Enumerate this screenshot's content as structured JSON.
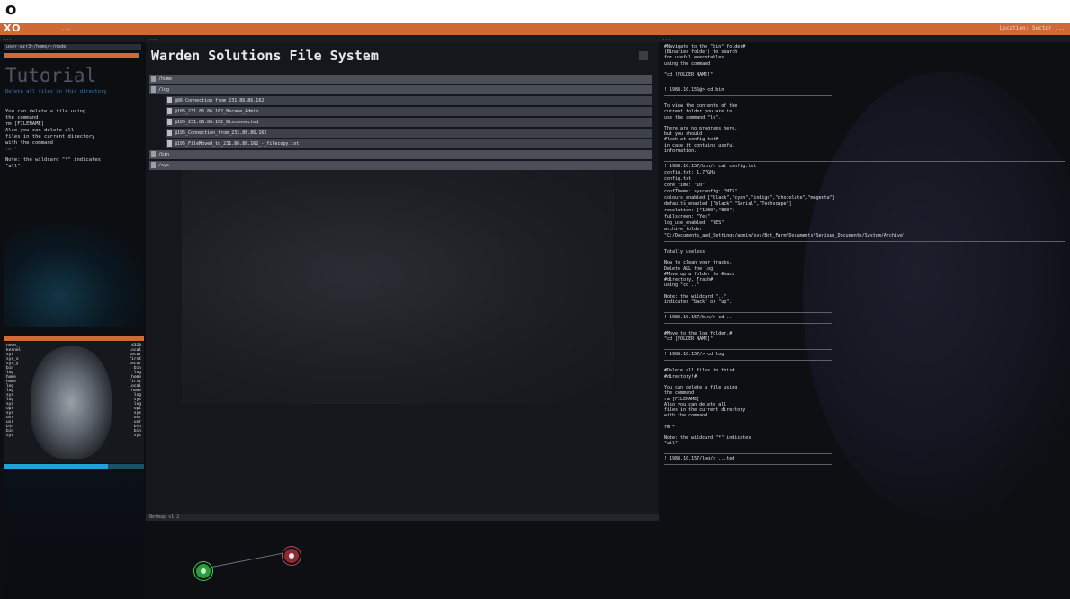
{
  "outer": {
    "mark": "o"
  },
  "topbar": {
    "logo": "XO",
    "small": "...",
    "right": "Location: Sector  ..."
  },
  "left": {
    "panel_title": "...",
    "path": "user-ezr3~/home/~/node",
    "tutorial_title": "Tutorial",
    "subtitle": "Delete all files in this directory",
    "body": "You can delete a file using\nthe command\nrm [FILENAME]\nAlso you can delete all\nfiles in the current directory\nwith the command",
    "tag": "rm *",
    "note": "Note: the wildcard \"*\" indicates\n\"all\".",
    "ram_col1": "node_\nkernel\nsys\nsys_x\nsys_y\nbin\nlog\nhome\nhome\nlog\nlog\nsys\nlog\nsys\nopt\nsys\nusr\nusr\nbin\nbin\nsys",
    "ram_col2": "4320\nlocal\nsecur\nfirst\nsecur\nbin\nlog\nhome\nfirst\nlocal\nhome\nlog\nsys\nlog\nopt\nsys\nusr\nusr\nbin\nbin\nsys"
  },
  "mid": {
    "panel_title": "...",
    "title": "Warden Solutions File System",
    "tree": [
      {
        "label": "/home",
        "type": "folder"
      },
      {
        "label": "/log",
        "type": "folder"
      },
      {
        "label": "@86_Connection_from_231.86.86.162",
        "type": "file"
      },
      {
        "label": "@105_231.86.86.162_Became_Admin",
        "type": "file"
      },
      {
        "label": "@105_231.86.86.162_Disconnected",
        "type": "file"
      },
      {
        "label": "@195_Connection_from_231.86.86.162",
        "type": "file"
      },
      {
        "label": "@195_FileMoved_to_231.86.86.162_-_filecopy.txt",
        "type": "file"
      },
      {
        "label": "/bin",
        "type": "folder"
      },
      {
        "label": "/sys",
        "type": "folder"
      }
    ],
    "display_title": "Netmap v1.2"
  },
  "right": {
    "panel_title": "...",
    "lines": [
      "#Navigate to the \"bin\" folder#\n(Binaries folder) to search\nfor useful executables\nusing the command\n\n\"cd [FOLDER NAME]\"",
      "! 1988.10.155@> cd bin",
      "To view the contents of the\ncurrent folder you are in\nuse the command \"ls\".\n\nThere are no programs here,\nbut you should\n#look at config.txt#\nin case it contains useful\ninformation.",
      "! 1988.10.157/bin/> cat config.txt\nconfig.txt: 1.77GHz\nconfig.txt\ncore_time: \"10\"\nconfTheme: sysconfig: \"HTS\"\ncolours_enabled [\"black\",\"cyan\",\"indigo\",\"chocolate\",\"magenta\"]\ndefaults_enabled [\"black\",\"Serial\",\"Techscape\"]\nresolution: [\"1280\",\"800\"]\nfullscreen: \"Yes\"\nlog_use_enabled: \"YES\"\narchive_folder\n\"C:/Documents_and_Settings/admin/sys/Bot_Farm/Documents/Serious_Documents/System/Archive\"",
      "Totally useless!\n\nNow to clean your tracks.\nDelete ALL the log\n#Move up a folder to #back\n#directory, Trash#\nusing \"cd ..\"\n\nNote: the wildcard \"..\"\nindicates \"back\" or \"up\".",
      "! 1988.10.157/bin/> cd ..",
      "#Move to the log folder.#\n\"cd [FOLDER NAME]\"",
      "! 1988.10.157/> cd log",
      "#Delete all files in this#\n#directory!#\n\nYou can delete a file using\nthe command\nrm [FILENAME]\nAlso you can delete all\nfiles in the current directory\nwith the command\n\nrm *\n\nNote: the wildcard \"*\" indicates\n\"all\".",
      "! 1988.10.157/log/> ...ted"
    ]
  },
  "colors": {
    "accent": "#cf6a36",
    "bar": "#1ea3d6",
    "node_player": "#3fd34f",
    "node_target": "#c74a59"
  },
  "icons": [
    "close-icon",
    "node-icon"
  ]
}
